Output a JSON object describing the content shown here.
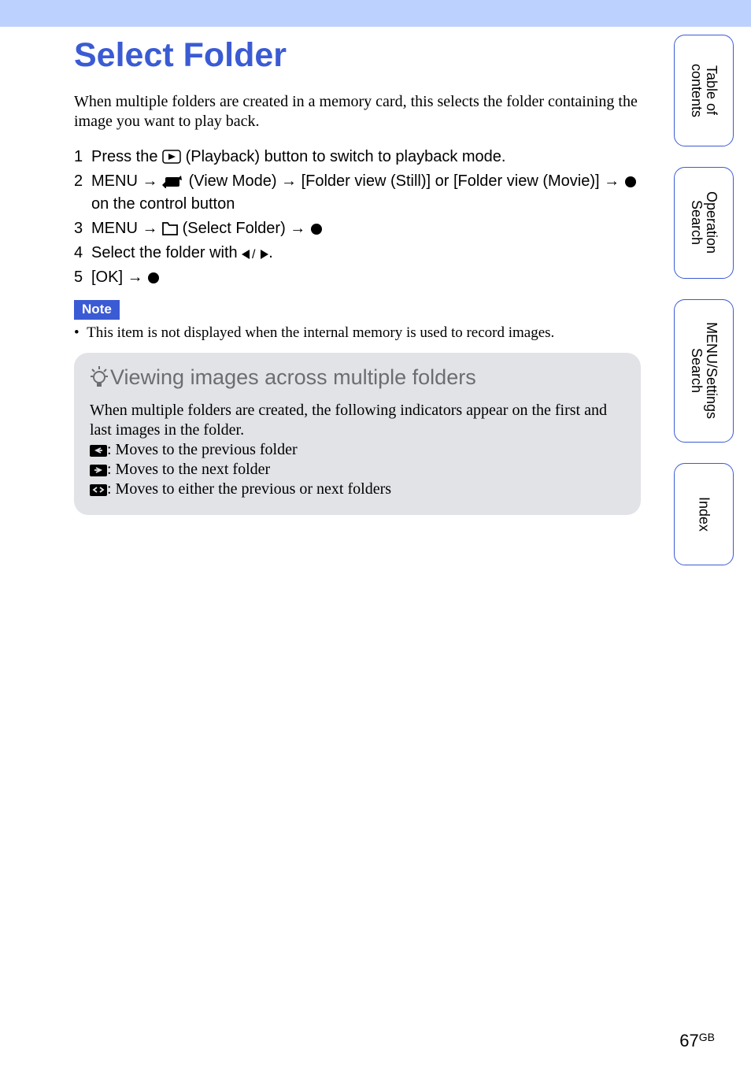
{
  "title": "Select Folder",
  "intro": "When multiple folders are created in a memory card, this selects the folder containing the image you want to play back.",
  "steps": {
    "s1_a": "Press the ",
    "s1_b": " (Playback) button to switch to playback mode.",
    "s2_a": "MENU ",
    "s2_b": " (View Mode) ",
    "s2_c": " [Folder view (Still)] or [Folder view (Movie)] ",
    "s2_d": " on the control button",
    "s3_a": "MENU ",
    "s3_b": " (Select Folder) ",
    "s4": "Select the folder with ",
    "s5": "[OK] "
  },
  "arrow": "→",
  "note_label": "Note",
  "note_text": "This item is not displayed when the internal memory is used to record images.",
  "tip_title": "Viewing images across multiple folders",
  "tip_intro": "When multiple folders are created, the following indicators appear on the first and last images in the folder.",
  "tip_prev": ": Moves to the previous folder",
  "tip_next": ": Moves to the next folder",
  "tip_both": ": Moves to either the previous or next folders",
  "page_number": "67",
  "page_region": "GB",
  "tabs": {
    "toc": "Table of contents",
    "op": "Operation Search",
    "menu": "MENU/Settings Search",
    "index": "Index"
  }
}
